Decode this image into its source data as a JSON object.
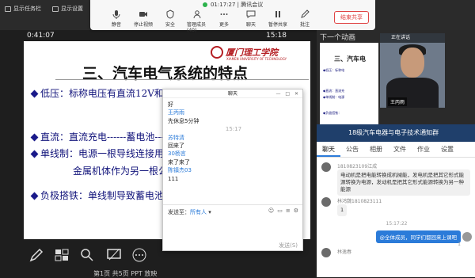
{
  "top_left": {
    "show_taskbar": "显示任务栏",
    "display_settings": "显示设置"
  },
  "meeting": {
    "status_time": "01:17:27",
    "app_name": "腾讯会议",
    "tools": [
      {
        "label": "静音",
        "icon": "microphone-icon"
      },
      {
        "label": "停止视频",
        "icon": "video-camera-icon"
      },
      {
        "label": "安全",
        "icon": "shield-icon"
      },
      {
        "label": "管理成员(40)",
        "icon": "members-icon"
      },
      {
        "label": "更多",
        "icon": "more-icon"
      },
      {
        "label": "聊天",
        "icon": "chat-icon"
      },
      {
        "label": "暂停共享",
        "icon": "pause-icon"
      },
      {
        "label": "批注",
        "icon": "pen-icon"
      }
    ],
    "end_share": "结束共享"
  },
  "slide": {
    "elapsed": "0:41:07",
    "clock": "15:18",
    "title": "三、汽车电气系统的特点",
    "logo_cn": "厦门理工学院",
    "logo_en": "XIAMEN UNIVERSITY OF TECHNOLOGY",
    "lines": [
      "低压：标称电压有直流12V和24V",
      "直流：直流充电------蓄电池----供",
      "单线制：电源一根导线连接用电",
      "金属机体作为另一根公",
      "负极搭铁：单线制导致蓄电池一"
    ]
  },
  "bottom_caption": "第1页 共5页  PPT 放映",
  "chat_popup": {
    "title": "聊天",
    "controls": "— □ ✕",
    "messages": [
      {
        "type": "text",
        "value": "好"
      },
      {
        "type": "name",
        "value": "王丙雨"
      },
      {
        "type": "text",
        "value": "先休息5分钟"
      },
      {
        "type": "time",
        "value": "15:17"
      },
      {
        "type": "name",
        "value": "苏特清"
      },
      {
        "type": "text",
        "value": "回来了"
      },
      {
        "type": "name",
        "value": "30杨言"
      },
      {
        "type": "text",
        "value": "来了来了"
      },
      {
        "type": "name",
        "value": "陈镇杰03"
      },
      {
        "type": "text",
        "value": "111"
      }
    ],
    "send_to_label": "发送至：",
    "send_to_target": "所有人",
    "input_icons": [
      "☺",
      "▭",
      "≡",
      "⚙"
    ],
    "send_button": "发送(S)"
  },
  "right_panel": {
    "next_label": "下一个动画",
    "preview_title": "三、汽车电",
    "preview_lines": [
      "◆低压：标称电",
      "◆直流：直流充",
      "◆单线制：电源",
      "◆负极搭铁："
    ],
    "video_header": "正在讲话",
    "video_name": "王丙雨"
  },
  "class_chat": {
    "title": "18级汽车电器与电子技术通知群",
    "tabs": [
      "聊天",
      "公告",
      "相册",
      "文件",
      "作业",
      "设置"
    ],
    "active_tab": "聊天",
    "msgs": [
      {
        "name": "1810823109江成",
        "text": "电动机是把电能转换成机械能，发电机是把其它形式能源转换为电源，发动机是把其它形式能源转换为另一种能源"
      },
      {
        "name": "林鸿魏1810823111",
        "text": "1"
      }
    ],
    "time": "15:17:22",
    "mine": "@全体成员，同学们都回来上课吧",
    "mine_count": "1",
    "last_name": "林逸春"
  },
  "colors": {
    "accent": "#2b7bd9",
    "danger": "#e04545",
    "slide_text": "#10127a",
    "logo": "#b51e23",
    "group_header": "#1f3f6b"
  }
}
